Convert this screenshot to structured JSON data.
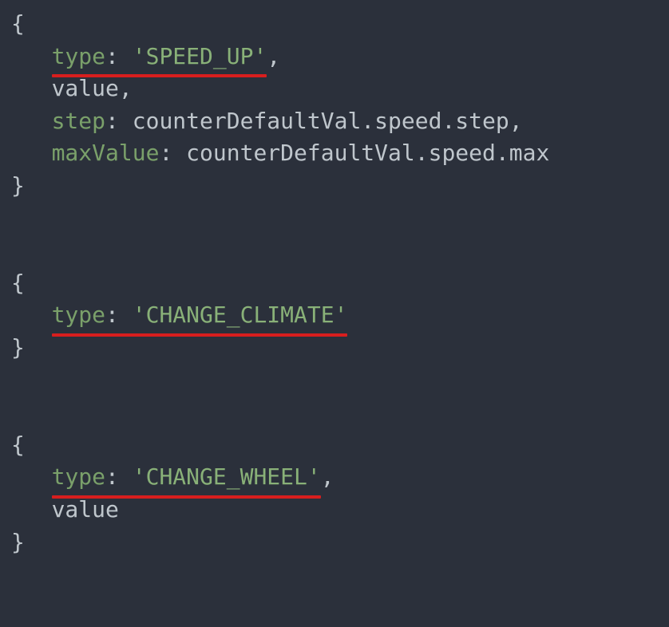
{
  "code": {
    "block1": {
      "open": "{",
      "line1_key": "type",
      "line1_colon": ":",
      "line1_string": "'SPEED_UP'",
      "line1_trail": ",",
      "line2": "value,",
      "line3_key": "step",
      "line3_colon": ":",
      "line3_rest": " counterDefaultVal.speed.step,",
      "line4_key": "maxValue",
      "line4_colon": ":",
      "line4_rest": " counterDefaultVal.speed.max",
      "close": "}"
    },
    "block2": {
      "open": "{",
      "line1_key": "type",
      "line1_colon": ":",
      "line1_string": "'CHANGE_CLIMATE'",
      "close": "}"
    },
    "block3": {
      "open": "{",
      "line1_key": "type",
      "line1_colon": ":",
      "line1_string": "'CHANGE_WHEEL'",
      "line1_trail": ",",
      "line2": "value",
      "close": "}"
    }
  }
}
